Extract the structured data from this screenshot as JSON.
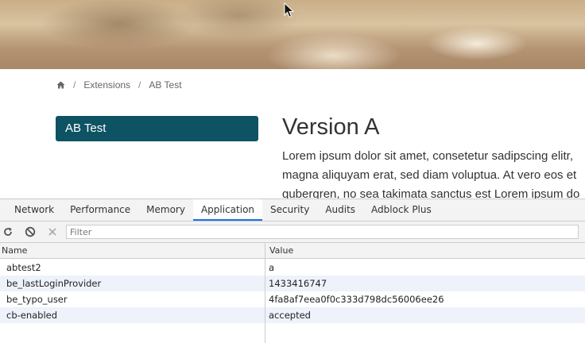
{
  "breadcrumb": {
    "home_icon": "home-icon",
    "separator": "/",
    "items": [
      "Extensions",
      "AB Test"
    ]
  },
  "sidebar": {
    "title": "AB Test"
  },
  "content": {
    "title": "Version A",
    "lines": [
      "Lorem ipsum dolor sit amet, consetetur sadipscing elitr,",
      "magna aliquyam erat, sed diam voluptua. At vero eos et",
      "gubergren, no sea takimata sanctus est Lorem ipsum do"
    ]
  },
  "devtools": {
    "tabs": [
      "Network",
      "Performance",
      "Memory",
      "Application",
      "Security",
      "Audits",
      "Adblock Plus"
    ],
    "active_tab": "Application",
    "toolbar": {
      "icons": [
        "refresh-icon",
        "clear-all-icon",
        "delete-icon"
      ],
      "filter_placeholder": "Filter"
    },
    "table": {
      "columns": [
        "Name",
        "Value"
      ],
      "rows": [
        {
          "name": "abtest2",
          "value": "a"
        },
        {
          "name": "be_lastLoginProvider",
          "value": "1433416747"
        },
        {
          "name": "be_typo_user",
          "value": "4fa8af7eea0f0c333d798dc56006ee26"
        },
        {
          "name": "cb-enabled",
          "value": "accepted"
        }
      ]
    }
  },
  "colors": {
    "sidebar_bg": "#0d5363",
    "active_tab_underline": "#1a73e8",
    "alt_row_bg": "#eef2fa"
  }
}
